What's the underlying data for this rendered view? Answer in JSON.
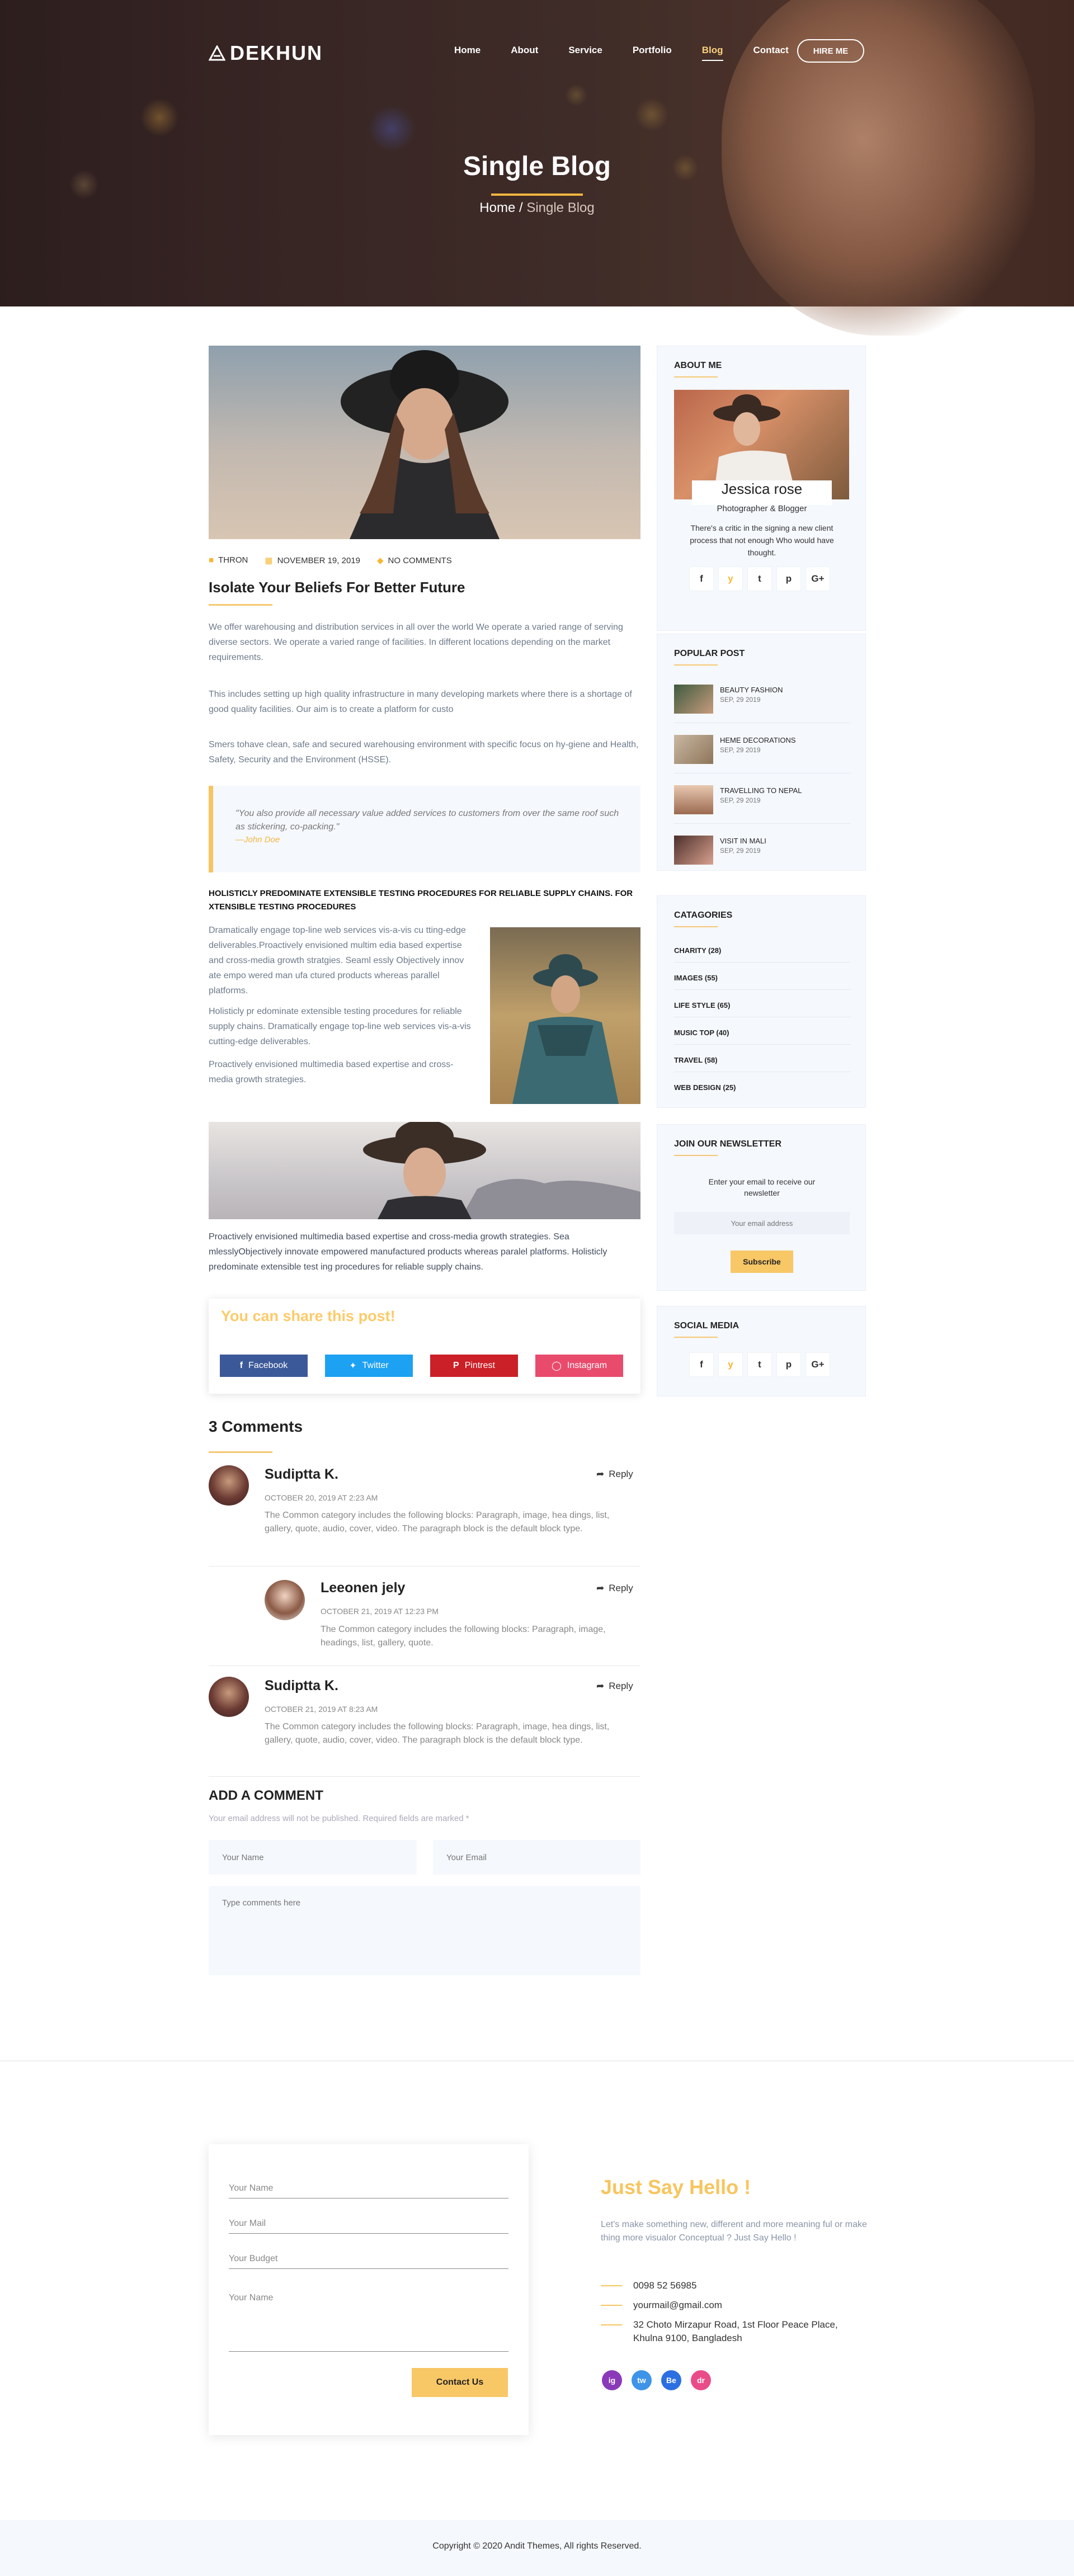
{
  "header": {
    "logo": "DEKHUN",
    "nav": [
      "Home",
      "About",
      "Service",
      "Portfolio",
      "Blog",
      "Contact"
    ],
    "active_nav": "Blog",
    "hire_label": "HIRE ME",
    "page_title": "Single Blog",
    "breadcrumb_home": "Home",
    "breadcrumb_sep": "/",
    "breadcrumb_current": "Single Blog"
  },
  "post": {
    "author": "THRON",
    "date": "NOVEMBER 19, 2019",
    "comments": "NO COMMENTS",
    "title": "Isolate Your Beliefs For Better Future",
    "para1": "We offer warehousing and distribution services in all over the world We operate a varied range of serving diverse sectors. We operate a varied range of facilities. In different locations depending on the market requirements.",
    "para2": "This includes setting up high quality infrastructure in many developing markets where there is a shortage of good quality facilities. Our aim is to create a platform for custo",
    "para3": "Smers tohave clean, safe and secured warehousing environment with specific focus on hy-giene and Health, Safety, Security and the Environment (HSSE).",
    "quote": "\"You also provide all necessary value added services to customers from over the same roof such as stickering, co-packing.\"",
    "quote_author": "—John Doe",
    "caps_heading": "HOLISTICLY PREDOMINATE EXTENSIBLE TESTING PROCEDURES FOR RELIABLE SUPPLY CHAINS. FOR XTENSIBLE TESTING PROCEDURES",
    "side_para1": "Dramatically engage top-line web services vis-a-vis cu tting-edge deliverables.Proactively envisioned multim edia based expertise and cross-media growth stratgies. Seaml essly Objectively innov ate empo wered man ufa ctured products whereas parallel platforms.",
    "side_para2": "Holisticly pr edominate extensible testing procedures for reliable supply chains. Dramatically engage top-line web services vis-a-vis cutting-edge deliverables.",
    "side_para3": "Proactively envisioned multimedia based expertise and cross-media growth strategies.",
    "bottom_para": "Proactively envisioned multimedia based expertise and cross-media growth strategies. Sea mlesslyObjectively innovate empowered manufactured   products whereas paralel platforms. Holisticly predominate extensible test ing procedures for reliable supply chains."
  },
  "share": {
    "title": "You can share this post!",
    "buttons": [
      "Facebook",
      "Twitter",
      "Pintrest",
      "Instagram"
    ],
    "colors": [
      "#3b5998",
      "#1da1f2",
      "#cb2027",
      "#e94b6d"
    ]
  },
  "comments": {
    "title": "3 Comments",
    "reply_label": "Reply",
    "items": [
      {
        "name": "Sudiptta K.",
        "date": "OCTOBER 20, 2019 AT 2:23 AM",
        "text": "The Common category includes the following blocks: Paragraph, image, hea dings, list, gallery, quote, audio, cover, video. The paragraph block is the default block type."
      },
      {
        "name": "Leeonen jely",
        "date": "OCTOBER 21, 2019 AT 12:23 PM",
        "text": "The Common category includes the following blocks: Paragraph, image, headings, list, gallery, quote."
      },
      {
        "name": "Sudiptta K.",
        "date": "OCTOBER 21, 2019 AT 8:23 AM",
        "text": "The Common category includes the following blocks: Paragraph, image, hea dings, list, gallery, quote, audio, cover, video. The paragraph block is the default block type."
      }
    ]
  },
  "comment_form": {
    "title": "ADD A COMMENT",
    "note": "Your email address will not be published. Required fields are marked *",
    "name_placeholder": "Your Name",
    "email_placeholder": "Your Email",
    "comment_placeholder": "Type comments here"
  },
  "sidebar": {
    "about": {
      "title": "ABOUT ME",
      "name": "Jessica rose",
      "role": "Photographer & Blogger",
      "bio": "There's a critic in the signing a new client process that not enough Who would have thought."
    },
    "social_icons": [
      "f",
      "y",
      "t",
      "p",
      "G+"
    ],
    "popular": {
      "title": "POPULAR POST",
      "items": [
        {
          "title": "BEAUTY FASHION",
          "date": "SEP, 29 2019"
        },
        {
          "title": "HEME DECORATIONS",
          "date": "SEP, 29 2019"
        },
        {
          "title": "TRAVELLING TO NEPAL",
          "date": "SEP, 29 2019"
        },
        {
          "title": "VISIT IN MALI",
          "date": "SEP, 29 2019"
        }
      ]
    },
    "categories": {
      "title": "CATAGORIES",
      "items": [
        "CHARITY  (28)",
        "IMAGES  (55)",
        "LIFE STYLE  (65)",
        "MUSIC TOP  (40)",
        "TRAVEL  (58)",
        "WEB DESIGN  (25)"
      ]
    },
    "newsletter": {
      "title": "JOIN OUR NEWSLETTER",
      "text": "Enter your email to receive our newsletter",
      "placeholder": "Your email address",
      "button": "Subscribe"
    },
    "social_media": {
      "title": "SOCIAL MEDIA"
    }
  },
  "contact": {
    "fields": [
      "Your Name",
      "Your Mail",
      "Your Budget",
      "Your Name"
    ],
    "button": "Contact Us",
    "heading": "Just Say Hello !",
    "text": "Let's make something new, different and more meaning ful or make thing more visualor Conceptual ? Just Say Hello !",
    "phone": "0098 52 56985",
    "email": "yourmail@gmail.com",
    "address": "32 Choto Mirzapur Road, 1st Floor Peace Place, Khulna 9100, Bangladesh",
    "social": [
      "ig",
      "tw",
      "Be",
      "dr"
    ],
    "social_colors": [
      "#8a3ab9",
      "#3e94e8",
      "#2b6fe3",
      "#ea4c89"
    ]
  },
  "footer": {
    "copyright": "Copyright © 2020 Andit Themes, All rights Reserved."
  }
}
